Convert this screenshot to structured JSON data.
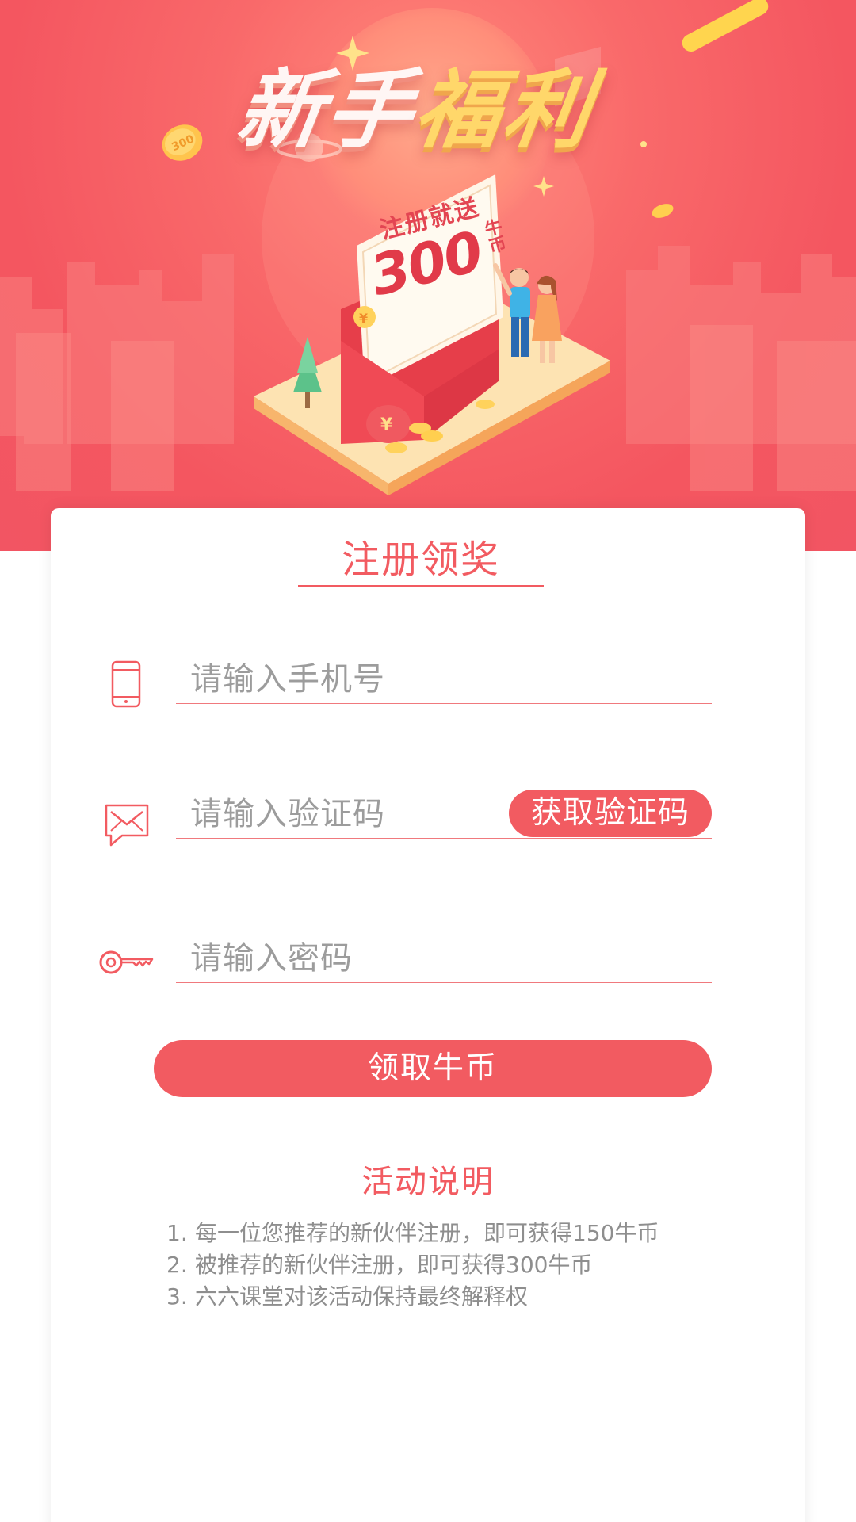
{
  "banner": {
    "title_part1": "新手",
    "title_part2": "福利",
    "coin_label": "300",
    "card_small_text": "注册就送",
    "card_amount": "300",
    "card_unit": "牛币"
  },
  "form": {
    "title": "注册领奖",
    "phone_placeholder": "请输入手机号",
    "code_placeholder": "请输入验证码",
    "code_button_label": "获取验证码",
    "password_placeholder": "请输入密码",
    "submit_label": "领取牛币"
  },
  "rules": {
    "title": "活动说明",
    "items": [
      {
        "num": "1.",
        "text": "每一位您推荐的新伙伴注册，即可获得150牛币"
      },
      {
        "num": "2.",
        "text": "被推荐的新伙伴注册，即可获得300牛币"
      },
      {
        "num": "3.",
        "text": "六六课堂对该活动保持最终解释权"
      }
    ]
  },
  "colors": {
    "accent": "#f25b61",
    "banner_bg": "#f45660",
    "placeholder": "#9c9c9c",
    "rules_text": "#8e8e8e",
    "gold": "#ffd76a"
  },
  "icons": [
    "phone-icon",
    "message-icon",
    "key-icon"
  ]
}
